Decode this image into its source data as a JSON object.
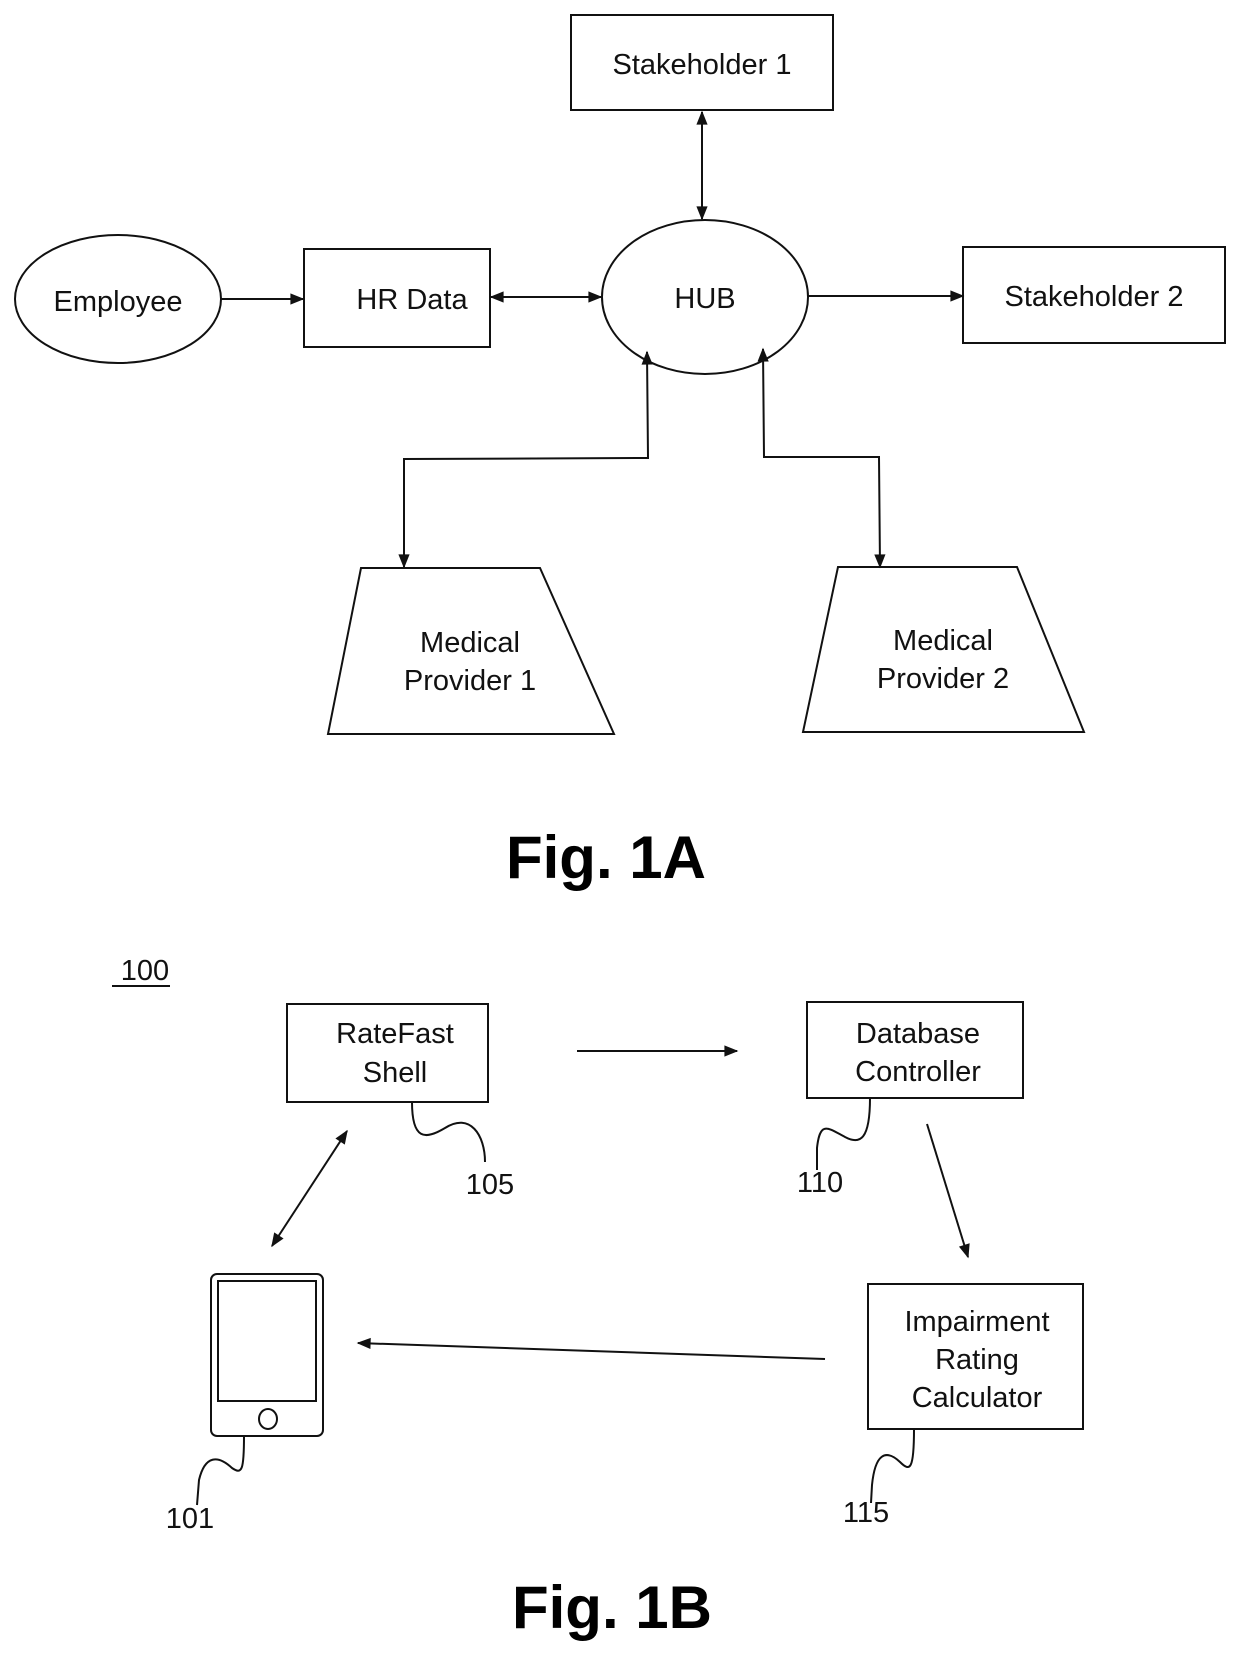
{
  "figure_1a": {
    "caption": "Fig. 1A",
    "nodes": {
      "employee": "Employee",
      "hr_data": "HR Data",
      "hub": "HUB",
      "stakeholder_1": "Stakeholder 1",
      "stakeholder_2": "Stakeholder 2",
      "medical_provider_1": [
        "Medical",
        "Provider 1"
      ],
      "medical_provider_2": [
        "Medical",
        "Provider 2"
      ]
    },
    "edges": [
      {
        "from": "Employee",
        "to": "HR Data",
        "direction": "one-way"
      },
      {
        "from": "HR Data",
        "to": "HUB",
        "direction": "bidirectional"
      },
      {
        "from": "HUB",
        "to": "Stakeholder 1",
        "direction": "bidirectional"
      },
      {
        "from": "HUB",
        "to": "Stakeholder 2",
        "direction": "one-way"
      },
      {
        "from": "HUB",
        "to": "Medical Provider 1",
        "direction": "bidirectional"
      },
      {
        "from": "HUB",
        "to": "Medical Provider 2",
        "direction": "bidirectional"
      }
    ]
  },
  "figure_1b": {
    "caption": "Fig. 1B",
    "system_ref": "100",
    "nodes": {
      "ratefast_shell": [
        "RateFast",
        "Shell"
      ],
      "database_controller": [
        "Database",
        "Controller"
      ],
      "impairment_rating_calculator": [
        "Impairment",
        "Rating",
        "Calculator"
      ],
      "mobile_device": "mobile-device"
    },
    "refs": {
      "mobile_device": "101",
      "ratefast_shell": "105",
      "database_controller": "110",
      "impairment_rating_calculator": "115"
    },
    "edges": [
      {
        "from": "RateFast Shell",
        "to": "Database Controller",
        "direction": "one-way"
      },
      {
        "from": "Database Controller",
        "to": "Impairment Rating Calculator",
        "direction": "one-way"
      },
      {
        "from": "Impairment Rating Calculator",
        "to": "Mobile Device",
        "direction": "one-way"
      },
      {
        "from": "Mobile Device",
        "to": "RateFast Shell",
        "direction": "bidirectional"
      }
    ]
  }
}
